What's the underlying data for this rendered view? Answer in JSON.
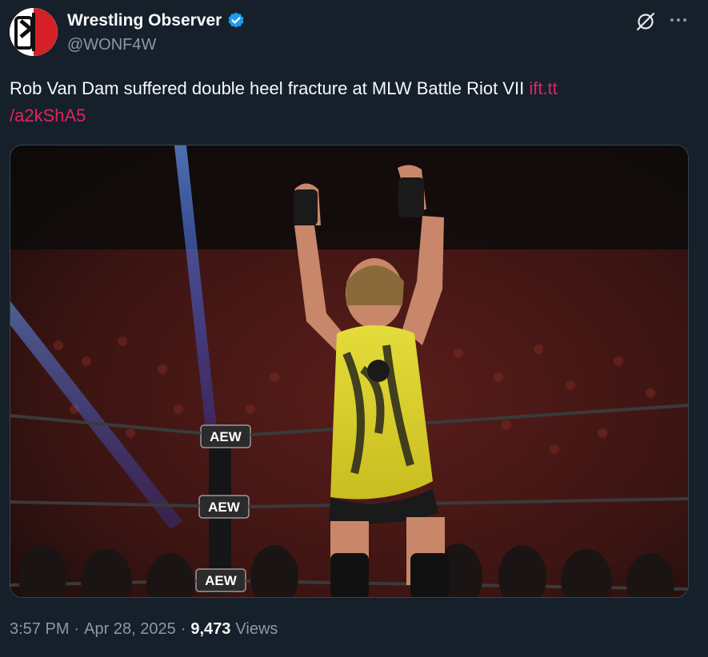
{
  "author": {
    "display_name": "Wrestling Observer",
    "handle": "@WONF4W",
    "verified": true
  },
  "tweet": {
    "text": "Rob Van Dam suffered double heel fracture at MLW Battle Riot VII ",
    "link_line1": "ift.tt",
    "link_line2": "/a2kShA5"
  },
  "media": {
    "ring_sign_1": "AEW",
    "ring_sign_2": "AEW",
    "ring_sign_3": "AEW"
  },
  "meta": {
    "time": "3:57 PM",
    "sep1": "·",
    "date": "Apr 28, 2025",
    "sep2": "·",
    "views_count": "9,473",
    "views_label": "Views"
  },
  "icons": {
    "avatar": "wrestling-observer-logo",
    "verified": "verified-badge-icon",
    "grok": "grok-icon",
    "more": "more-icon"
  },
  "colors": {
    "background": "#15202b",
    "text": "#f7f9f9",
    "secondary": "#8b98a5",
    "link": "#e0245e",
    "verified": "#1d9bf0"
  }
}
